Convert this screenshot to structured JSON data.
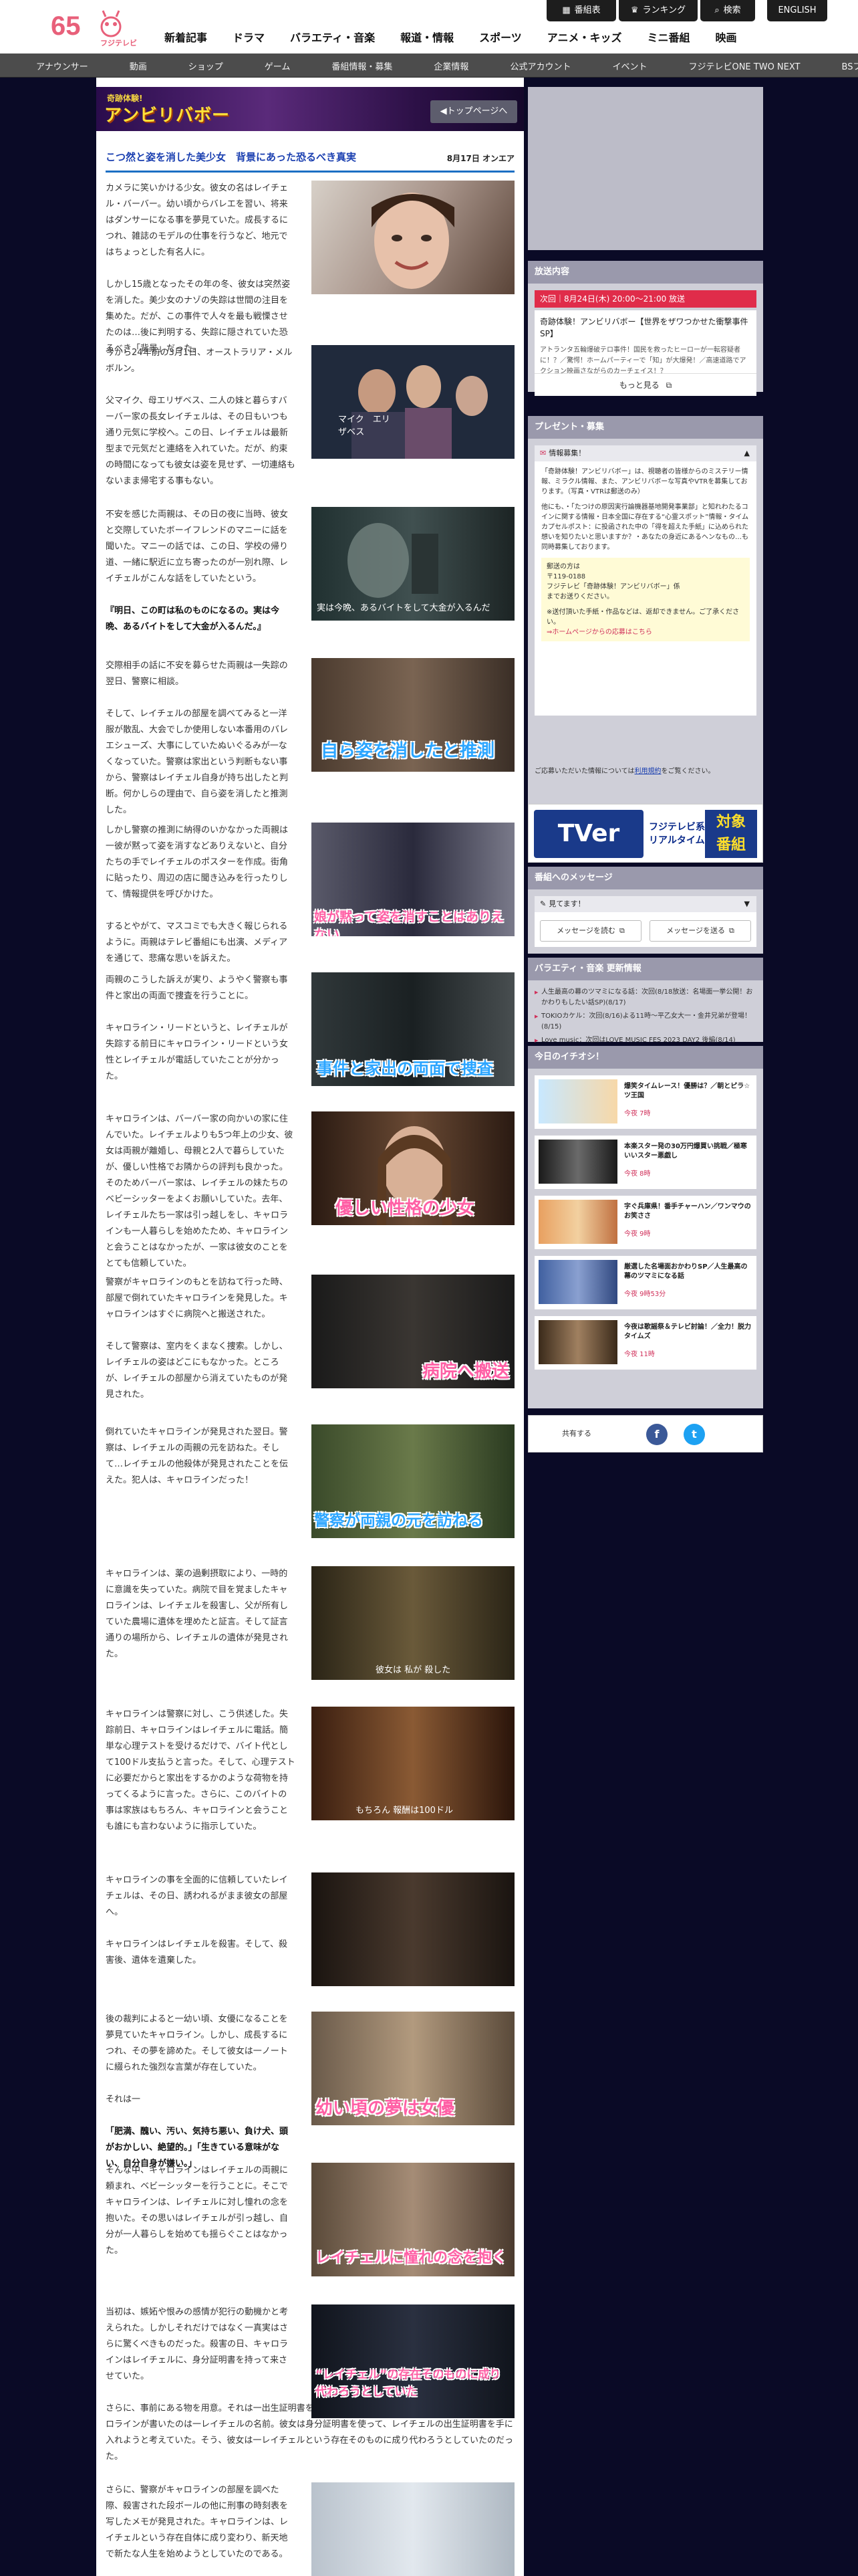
{
  "header": {
    "logo_number": "65",
    "logo_brand": "フジテレビ",
    "utility": [
      {
        "icon": "grid-icon",
        "label": "番組表"
      },
      {
        "icon": "ranking-icon",
        "label": "ランキング"
      },
      {
        "icon": "search-icon",
        "label": "検索"
      },
      {
        "label": "ENGLISH"
      }
    ],
    "nav": [
      "新着記事",
      "ドラマ",
      "バラエティ・音楽",
      "報道・情報",
      "スポーツ",
      "アニメ・キッズ",
      "ミニ番組",
      "映画"
    ],
    "subnav": [
      "アナウンサー",
      "動画",
      "ショップ",
      "ゲーム",
      "番組情報・募集",
      "企業情報",
      "公式アカウント",
      "イベント",
      "フジテレビONE TWO NEXT",
      "BSフジ"
    ]
  },
  "banner": {
    "logo_small": "奇跡体験!",
    "logo_large": "アンビリバボー",
    "back_label": "◀トップページへ"
  },
  "article": {
    "title": "こつ然と姿を消した美少女　背景にあった恐るべき真実",
    "date": "8月17日 オンエア",
    "sections": [
      {
        "paras": [
          "カメラに笑いかける少女。彼女の名はレイチェル・バーバー。幼い頃からバレエを習い、将来はダンサーになる事を夢見ていた。成長するにつれ、雑誌のモデルの仕事を行うなど、地元ではちょっとした有名人に。",
          "しかし15歳となったその年の冬、彼女は突然姿を消した。美少女のナゾの失踪は世間の注目を集めた。だが、この事件で人々を最も戦慄させたのは…後に判明する、失踪に隠されていた恐るべき「背景」だった。"
        ],
        "img_cap": ""
      },
      {
        "paras": [
          "今から24年前の3月1日、オーストラリア・メルボルン。",
          "父マイク、母エリザベス、二人の妹と暮らすバーバー家の長女レイチェルは、その日もいつも通り元気に学校へ。この日、レイチェルは最新型まで元気だと連絡を入れていた。だが、約束の時間になっても彼女は姿を見せず、一切連絡もないまま帰宅する事もない。"
        ],
        "img_cap": "マイク　エリザベス"
      },
      {
        "paras": [
          "不安を感じた両親は、その日の夜に当時、彼女と交際していたボーイフレンドのマニーに話を聞いた。マニーの話では、この日、学校の帰り道、一緒に駅近に立ち寄ったのが一別れ際、レイチェルがこんな話をしていたという。"
        ],
        "em": "『明日、この町は私のものになるの。実は今晩、あるバイトをして大金が入るんだ。』",
        "img_cap": "実は今晩、あるバイトをして大金が入るんだ"
      },
      {
        "paras": [
          "交際相手の話に不安を募らせた両親は一失踪の翌日、警察に相談。",
          "そして、レイチェルの部屋を調べてみると一洋服が散乱、大会でしか使用しない本番用のバレエシューズ、大事にしていたぬいぐるみが一なくなっていた。警察は家出という判断もない事から、警察はレイチェル自身が持ち出したと判断。何かしらの理由で、自ら姿を消したと推測した。"
        ],
        "img_cap": "自ら姿を消したと推測"
      },
      {
        "paras": [
          "しかし警察の推測に納得のいかなかった両親は一彼が黙って姿を消すなどありえないと、自分たちの手でレイチェルのポスターを作成。街角に貼ったり、周辺の店に聞き込みを行ったりして、情報提供を呼びかけた。",
          "するとやがて、マスコミでも大きく報じられるように。両親はテレビ番組にも出演、メディアを通じて、悲痛な思いを訴えた。"
        ],
        "img_cap": "娘が黙って姿を消すことはありえない"
      },
      {
        "paras": [
          "両親のこうした訴えが実り、ようやく警察も事件と家出の両面で捜査を行うことに。",
          "キャロライン・リードというと、レイチェルが失踪する前日にキャロライン・リードという女性とレイチェルが電話していたことが分かった。"
        ],
        "img_cap": "事件と家出の両面で捜査"
      },
      {
        "paras": [
          "キャロラインは、バーバー家の向かいの家に住んでいた。レイチェルよりも5つ年上の少女、彼女は両親が離婚し、母親と2人で暮らしていたが、優しい性格でお隣からの評判も良かった。そのためバーバー家は、レイチェルの妹たちのベビーシッターをよくお願いしていた。去年、レイチェルたち一家は引っ越しをし、キャロラインも一人暮らしを始めたため、キャロラインと会うことはなかったが、一家は彼女のことをとても信頼していた。"
        ],
        "img_cap": "優しい性格の少女"
      },
      {
        "paras": [
          "警察がキャロラインのもとを訪ねて行った時、部屋で倒れていたキャロラインを発見した。キャロラインはすぐに病院へと搬送された。",
          "そして警察は、室内をくまなく捜索。しかし、レイチェルの姿はどこにもなかった。ところが、レイチェルの部屋から消えていたものが発見された。"
        ],
        "img_cap": "病院へ搬送"
      },
      {
        "paras": [
          "倒れていたキャロラインが発見された翌日。警察は、レイチェルの両親の元を訪ねた。そして…レイチェルの他殺体が発見されたことを伝えた。犯人は、キャロラインだった！"
        ],
        "img_cap": "警察が両親の元を訪ねる"
      },
      {
        "paras": [
          "キャロラインは、薬の過剰摂取により、一時的に意識を失っていた。病院で目を覚ましたキャロラインは、レイチェルを殺害し、父が所有していた農場に遺体を埋めたと証言。そして証言通りの場所から、レイチェルの遺体が発見された。"
        ],
        "img_cap": "彼女は 私が 殺した"
      },
      {
        "paras": [
          "キャロラインは警察に対し、こう供述した。失踪前日、キャロラインはレイチェルに電話。簡単な心理テストを受けるだけで、バイト代として100ドル支払うと言った。そして、心理テストに必要だからと家出をするかのような荷物を持ってくるように言った。さらに、このバイトの事は家族はもちろん、キャロラインと会うことも誰にも言わないように指示していた。"
        ],
        "img_cap": "もちろん 報酬は100ドル"
      },
      {
        "paras": [
          "キャロラインの事を全面的に信頼していたレイチェルは、その日、誘われるがまま彼女の部屋へ。",
          "キャロラインはレイチェルを殺害。そして、殺害後、遺体を遺棄した。"
        ],
        "img_cap": ""
      },
      {
        "paras": [
          "後の裁判によると一幼い頃、女優になることを夢見ていたキャロライン。しかし、成長するにつれ、その夢を諦めた。そして彼女は一ノートに綴られた強烈な言葉が存在していた。",
          "それは一"
        ],
        "em": "「肥満、醜い、汚い、気持ち悪い、負け犬、頭がおかしい、絶望的。」「生きている意味がない、自分自身が嫌い。」",
        "img_cap": "幼い頃の夢は女優"
      },
      {
        "paras": [
          "そんな中、キャロラインはレイチェルの両親に頼まれ、ベビーシッターを行うことに。そこでキャロラインは、レイチェルに対し憧れの念を抱いた。その思いはレイチェルが引っ越し、自分が一人暮らしを始めても揺らぐことはなかった。"
        ],
        "img_cap": "レイチェルに憧れの念を抱く"
      },
      {
        "paras": [
          "当初は、嫉妬や恨みの感情が犯行の動機かと考えられた。しかしそれだけではなく一真実はさらに驚くべきものだった。殺害の日、キャロラインはレイチェルに、身分証明書を持って来させていた。",
          "さらに、事前にある物を用意。それは一出生証明書を取り寄せるための申請書。その申請者の欄に、キャロラインが書いたのは一レイチェルの名前。彼女は身分証明書を使って、レイチェルの出生証明書を手に入れようと考えていた。そう、彼女は一レイチェルという存在そのものに成り代わろうとしていたのだった。"
        ],
        "img_cap": "“レイチェル”の存在そのものに成り代わろうとしていた"
      },
      {
        "paras": [
          "さらに、警察がキャロラインの部屋を調べた際、殺害された段ボールの他に刑事の時刻表を写したメモが発見された。キャロラインは、レイチェルという存在自体に成り変わり、新天地で新たな人生を始めようとしていたのである。"
        ],
        "img_cap": ""
      }
    ]
  },
  "sidebar": {
    "broadcast": {
      "heading": "放送内容",
      "time": "次回｜8月24日(木) 20:00〜21:00 放送",
      "program": "奇跡体験！アンビリバボー【世界をザワつかせた衝撃事件SP】",
      "desc": "アトランタ五輪爆破テロ事件！国民を救ったヒーローが一転容疑者に！？／驚愕！ホームパーティーで「知」が大爆発！／高速道路でアクション映画さながらのカーチェイス！？",
      "more": "もっと見る"
    },
    "present": {
      "heading": "プレゼント・募集",
      "bar": "情報募集！",
      "body_1": "「奇跡体験！アンビリバボー」は、視聴者の皆様からのミステリー情報、ミラクル情報、また、アンビリバボーな写真やVTRを募集しております。（写真・VTRは郵送のみ）",
      "body_2": "他にも、・「たつけの原因実行論機器基地開発事業部」と知れわたるコインに関する情報・日本全国に存在する“心霊スポット”情報・タイムカプセルポスト：に投函された中の「得を超えた手紙」に込められた想いを知りたいと思いますか？・あなたの身近にあるヘンなもの…も同時募集しております。",
      "address_label": "郵送の方は",
      "address_zip": "〒119-0188",
      "address_dest": "フジテレビ「奇跡体験！アンビリバボー」係",
      "address_end": "までお送りください。",
      "note": "※送付頂いた手紙・作品などは、返却できません。ご了承ください。",
      "link": "⇒ホームページからの応募はこちら",
      "foot_pre": "ご応募いただいた情報については",
      "foot_link": "利用規約",
      "foot_post": "をご覧ください。"
    },
    "tver": {
      "logo": "TVer",
      "line_1": "フジテレビ系",
      "line_2": "リアルタイム配信",
      "badge_1": "対象",
      "badge_2": "番組"
    },
    "message": {
      "heading": "番組へのメッセージ",
      "bar": "見てます！",
      "read": "メッセージを読む",
      "send": "メッセージを送る"
    },
    "variety": {
      "heading": "バラエティ・音楽 更新情報",
      "items": [
        "人生最高の幕のツマミになる話：次回(8/18放送：名場面一挙公開！おかわりもしたい話SP)(8/17)",
        "TOKIOカケル：次回(8/16)よる11時〜平乙女大一・金井兄弟が登場！(8/15)",
        "Love music：次回はLOVE MUSIC FES 2023 DAY2 後編(8/14)"
      ]
    },
    "ichioshi": {
      "heading": "今日のイチオシ！",
      "items": [
        {
          "title": "爆笑タイムレース！優勝は？／朝とピラ☆ツ王国",
          "date": "今夜 7時"
        },
        {
          "title": "本楽スター発の30万円爆買い挑戦／極寒いいスター悪戯し",
          "date": "今夜 8時"
        },
        {
          "title": "字ぐ兵庫県！番手チャーハン／ワンマウのお笑ささ",
          "date": "今夜 9時"
        },
        {
          "title": "厳選した名場面おかわりSP／人生最高の幕のツマミになる話",
          "date": "今夜 9時53分"
        },
        {
          "title": "今夜は歌謡祭＆テレビ討論！／全力！脱力タイムズ",
          "date": "今夜 11時"
        }
      ]
    },
    "share": {
      "label": "共有する",
      "facebook": "f",
      "twitter": "t"
    }
  }
}
